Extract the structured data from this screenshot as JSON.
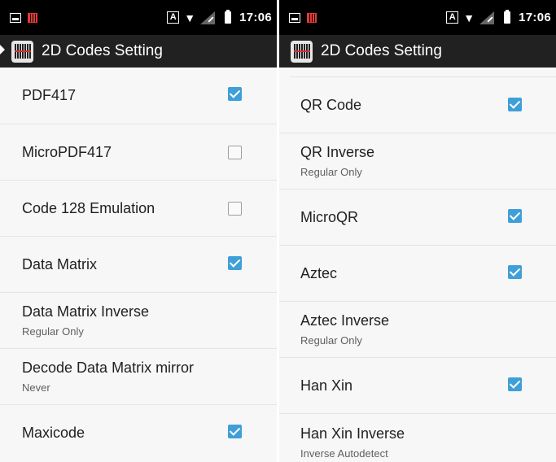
{
  "status_bar": {
    "time": "17:06",
    "input_indicator": "A"
  },
  "app_bar": {
    "title": "2D Codes Setting"
  },
  "left_list": [
    {
      "title": "PDF417",
      "summary": "",
      "checkbox": true,
      "checked": true
    },
    {
      "title": "MicroPDF417",
      "summary": "",
      "checkbox": true,
      "checked": false
    },
    {
      "title": "Code 128 Emulation",
      "summary": "",
      "checkbox": true,
      "checked": false
    },
    {
      "title": "Data Matrix",
      "summary": "",
      "checkbox": true,
      "checked": true
    },
    {
      "title": "Data Matrix Inverse",
      "summary": "Regular Only",
      "checkbox": false,
      "checked": false
    },
    {
      "title": "Decode Data Matrix mirror",
      "summary": "Never",
      "checkbox": false,
      "checked": false
    },
    {
      "title": "Maxicode",
      "summary": "",
      "checkbox": true,
      "checked": true
    }
  ],
  "right_list": [
    {
      "title": "QR Code",
      "summary": "",
      "checkbox": true,
      "checked": true
    },
    {
      "title": "QR Inverse",
      "summary": "Regular Only",
      "checkbox": false,
      "checked": false
    },
    {
      "title": "MicroQR",
      "summary": "",
      "checkbox": true,
      "checked": true
    },
    {
      "title": "Aztec",
      "summary": "",
      "checkbox": true,
      "checked": true
    },
    {
      "title": "Aztec Inverse",
      "summary": "Regular Only",
      "checkbox": false,
      "checked": false
    },
    {
      "title": "Han Xin",
      "summary": "",
      "checkbox": true,
      "checked": true
    },
    {
      "title": "Han Xin Inverse",
      "summary": "Inverse Autodetect",
      "checkbox": false,
      "checked": false
    }
  ],
  "colors": {
    "accent": "#3f9fd8",
    "app_bar": "#212121",
    "status_bar": "#000000",
    "background": "#f7f7f7"
  },
  "icons": [
    "image-icon",
    "barcode-notification-icon",
    "input-method-icon",
    "wifi-icon",
    "signal-icon",
    "battery-icon",
    "barcode-app-icon"
  ]
}
